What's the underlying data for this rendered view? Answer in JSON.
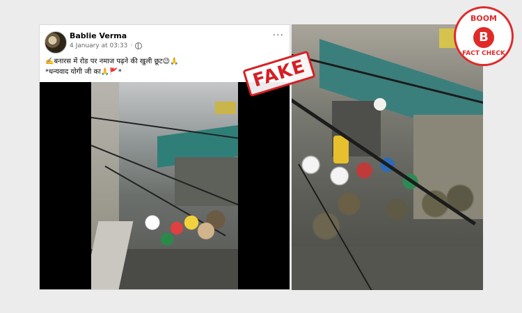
{
  "post": {
    "author": "Bablie Verma",
    "date": "4 January at 03:33",
    "caption_line1": "✍️बनारस में रोड पर नमाज पढ़ने की खुली छूट😉🙏",
    "caption_line2": "*धन्यवाद योगी जी का🙏🚩*"
  },
  "stamp": {
    "label": "FAKE"
  },
  "badge": {
    "top": "BOOM",
    "letter": "B",
    "bottom": "FACT CHECK"
  },
  "icons": {
    "avatar": "avatar-image",
    "privacy": "globe-icon",
    "more": "more-options-icon"
  },
  "colors": {
    "fake_red": "#d61f26",
    "boom_red": "#e02a2a"
  }
}
